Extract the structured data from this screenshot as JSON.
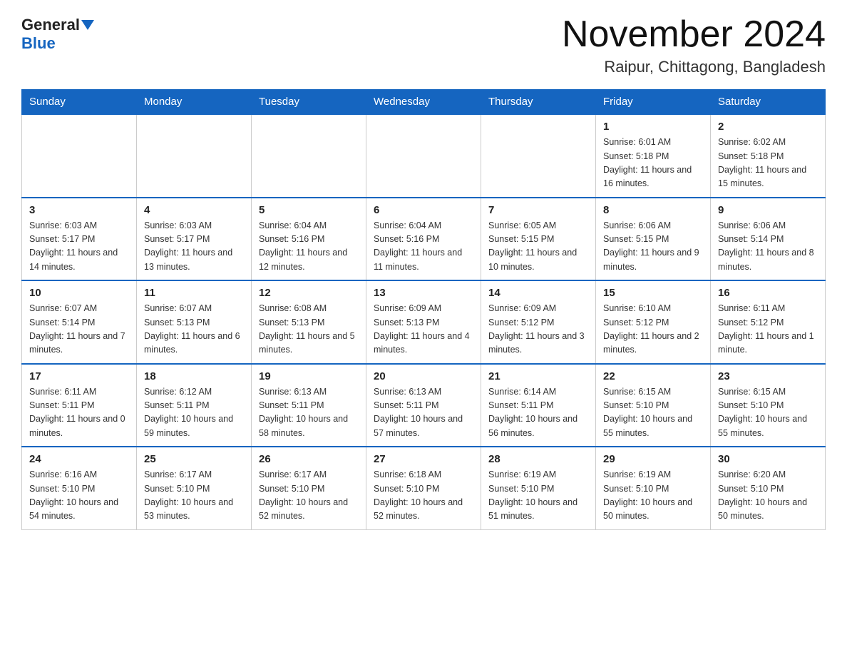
{
  "header": {
    "logo_general": "General",
    "logo_blue": "Blue",
    "month_title": "November 2024",
    "location": "Raipur, Chittagong, Bangladesh"
  },
  "weekdays": [
    "Sunday",
    "Monday",
    "Tuesday",
    "Wednesday",
    "Thursday",
    "Friday",
    "Saturday"
  ],
  "weeks": [
    [
      {
        "day": "",
        "info": ""
      },
      {
        "day": "",
        "info": ""
      },
      {
        "day": "",
        "info": ""
      },
      {
        "day": "",
        "info": ""
      },
      {
        "day": "",
        "info": ""
      },
      {
        "day": "1",
        "info": "Sunrise: 6:01 AM\nSunset: 5:18 PM\nDaylight: 11 hours and 16 minutes."
      },
      {
        "day": "2",
        "info": "Sunrise: 6:02 AM\nSunset: 5:18 PM\nDaylight: 11 hours and 15 minutes."
      }
    ],
    [
      {
        "day": "3",
        "info": "Sunrise: 6:03 AM\nSunset: 5:17 PM\nDaylight: 11 hours and 14 minutes."
      },
      {
        "day": "4",
        "info": "Sunrise: 6:03 AM\nSunset: 5:17 PM\nDaylight: 11 hours and 13 minutes."
      },
      {
        "day": "5",
        "info": "Sunrise: 6:04 AM\nSunset: 5:16 PM\nDaylight: 11 hours and 12 minutes."
      },
      {
        "day": "6",
        "info": "Sunrise: 6:04 AM\nSunset: 5:16 PM\nDaylight: 11 hours and 11 minutes."
      },
      {
        "day": "7",
        "info": "Sunrise: 6:05 AM\nSunset: 5:15 PM\nDaylight: 11 hours and 10 minutes."
      },
      {
        "day": "8",
        "info": "Sunrise: 6:06 AM\nSunset: 5:15 PM\nDaylight: 11 hours and 9 minutes."
      },
      {
        "day": "9",
        "info": "Sunrise: 6:06 AM\nSunset: 5:14 PM\nDaylight: 11 hours and 8 minutes."
      }
    ],
    [
      {
        "day": "10",
        "info": "Sunrise: 6:07 AM\nSunset: 5:14 PM\nDaylight: 11 hours and 7 minutes."
      },
      {
        "day": "11",
        "info": "Sunrise: 6:07 AM\nSunset: 5:13 PM\nDaylight: 11 hours and 6 minutes."
      },
      {
        "day": "12",
        "info": "Sunrise: 6:08 AM\nSunset: 5:13 PM\nDaylight: 11 hours and 5 minutes."
      },
      {
        "day": "13",
        "info": "Sunrise: 6:09 AM\nSunset: 5:13 PM\nDaylight: 11 hours and 4 minutes."
      },
      {
        "day": "14",
        "info": "Sunrise: 6:09 AM\nSunset: 5:12 PM\nDaylight: 11 hours and 3 minutes."
      },
      {
        "day": "15",
        "info": "Sunrise: 6:10 AM\nSunset: 5:12 PM\nDaylight: 11 hours and 2 minutes."
      },
      {
        "day": "16",
        "info": "Sunrise: 6:11 AM\nSunset: 5:12 PM\nDaylight: 11 hours and 1 minute."
      }
    ],
    [
      {
        "day": "17",
        "info": "Sunrise: 6:11 AM\nSunset: 5:11 PM\nDaylight: 11 hours and 0 minutes."
      },
      {
        "day": "18",
        "info": "Sunrise: 6:12 AM\nSunset: 5:11 PM\nDaylight: 10 hours and 59 minutes."
      },
      {
        "day": "19",
        "info": "Sunrise: 6:13 AM\nSunset: 5:11 PM\nDaylight: 10 hours and 58 minutes."
      },
      {
        "day": "20",
        "info": "Sunrise: 6:13 AM\nSunset: 5:11 PM\nDaylight: 10 hours and 57 minutes."
      },
      {
        "day": "21",
        "info": "Sunrise: 6:14 AM\nSunset: 5:11 PM\nDaylight: 10 hours and 56 minutes."
      },
      {
        "day": "22",
        "info": "Sunrise: 6:15 AM\nSunset: 5:10 PM\nDaylight: 10 hours and 55 minutes."
      },
      {
        "day": "23",
        "info": "Sunrise: 6:15 AM\nSunset: 5:10 PM\nDaylight: 10 hours and 55 minutes."
      }
    ],
    [
      {
        "day": "24",
        "info": "Sunrise: 6:16 AM\nSunset: 5:10 PM\nDaylight: 10 hours and 54 minutes."
      },
      {
        "day": "25",
        "info": "Sunrise: 6:17 AM\nSunset: 5:10 PM\nDaylight: 10 hours and 53 minutes."
      },
      {
        "day": "26",
        "info": "Sunrise: 6:17 AM\nSunset: 5:10 PM\nDaylight: 10 hours and 52 minutes."
      },
      {
        "day": "27",
        "info": "Sunrise: 6:18 AM\nSunset: 5:10 PM\nDaylight: 10 hours and 52 minutes."
      },
      {
        "day": "28",
        "info": "Sunrise: 6:19 AM\nSunset: 5:10 PM\nDaylight: 10 hours and 51 minutes."
      },
      {
        "day": "29",
        "info": "Sunrise: 6:19 AM\nSunset: 5:10 PM\nDaylight: 10 hours and 50 minutes."
      },
      {
        "day": "30",
        "info": "Sunrise: 6:20 AM\nSunset: 5:10 PM\nDaylight: 10 hours and 50 minutes."
      }
    ]
  ]
}
